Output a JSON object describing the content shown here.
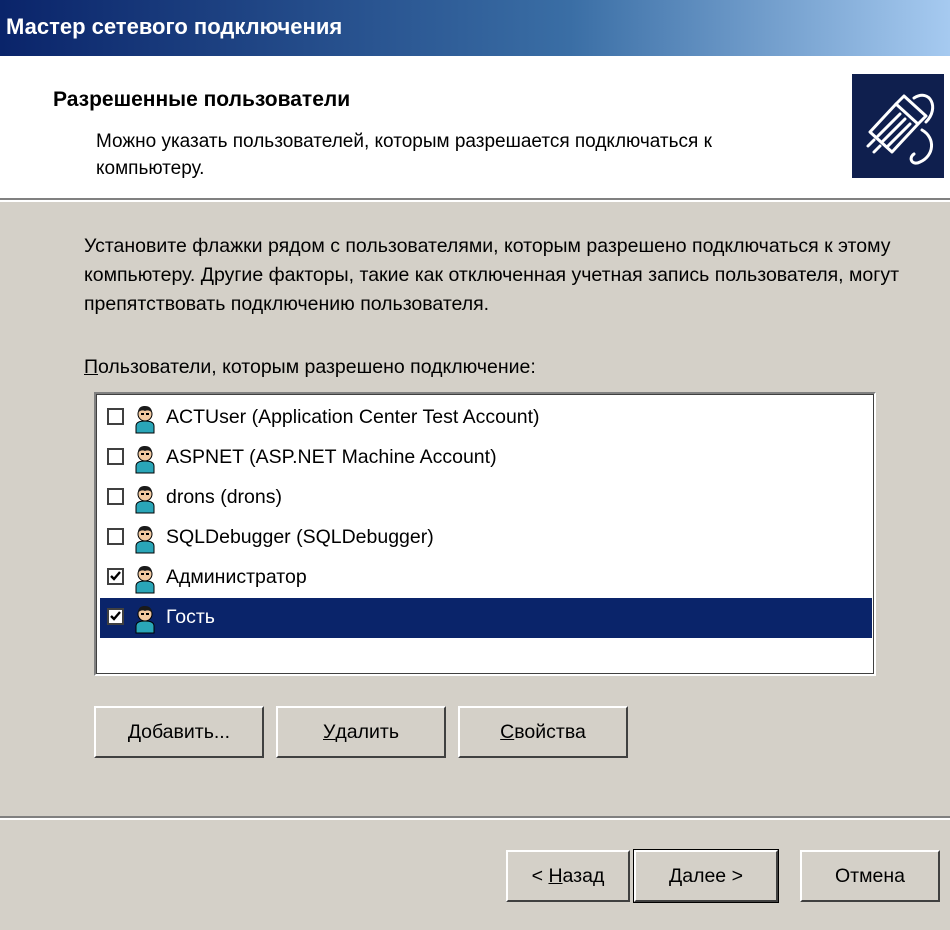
{
  "window": {
    "title": "Мастер сетевого подключения"
  },
  "header": {
    "title": "Разрешенные пользователи",
    "subtitle": "Можно указать пользователей, которым разрешается подключаться к компьютеру.",
    "icon": "network-cable-icon"
  },
  "body": {
    "instructions": "Установите флажки рядом с пользователями, которым разрешено подключаться к этому компьютеру. Другие факторы, такие как отключенная учетная запись пользователя, могут препятствовать подключению пользователя.",
    "list_label_first": "П",
    "list_label_rest": "ользователи, которым разрешено подключение:"
  },
  "users": [
    {
      "label": "ACTUser (Application Center Test Account)",
      "checked": false,
      "selected": false,
      "icon": "user-icon"
    },
    {
      "label": "ASPNET (ASP.NET Machine Account)",
      "checked": false,
      "selected": false,
      "icon": "user-icon"
    },
    {
      "label": "drons (drons)",
      "checked": false,
      "selected": false,
      "icon": "user-icon"
    },
    {
      "label": "SQLDebugger (SQLDebugger)",
      "checked": false,
      "selected": false,
      "icon": "user-icon"
    },
    {
      "label": "Администратор",
      "checked": true,
      "selected": false,
      "icon": "user-icon"
    },
    {
      "label": "Гость",
      "checked": true,
      "selected": true,
      "icon": "user-icon"
    }
  ],
  "list_buttons": {
    "add": {
      "mnemonic": "Д",
      "rest": "обавить..."
    },
    "remove": {
      "mnemonic": "У",
      "rest": "далить"
    },
    "properties": {
      "mnemonic": "С",
      "rest": "войства"
    }
  },
  "nav_buttons": {
    "back": {
      "prefix": "< ",
      "mnemonic": "Н",
      "rest": "азад"
    },
    "next": "Далее >",
    "cancel": "Отмена"
  },
  "colors": {
    "dialog_bg": "#d4d0c8",
    "title_bar_start": "#0a246a",
    "selection": "#0a246a",
    "header_icon_bg": "#0f1f4e"
  }
}
